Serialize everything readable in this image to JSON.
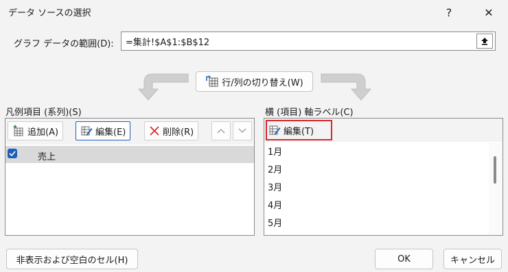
{
  "window": {
    "title": "データ ソースの選択",
    "help": "?",
    "close": "✕"
  },
  "range": {
    "label": "グラフ データの範囲(D):",
    "value": "=集計!$A$1:$B$12"
  },
  "switch_button": {
    "label": "行/列の切り替え(W)"
  },
  "legend": {
    "header": "凡例項目 (系列)(S)",
    "add": "追加(A)",
    "edit": "編集(E)",
    "delete": "削除(R)",
    "series": [
      {
        "label": "売上",
        "checked": true
      }
    ]
  },
  "axis": {
    "header": "横 (項目) 軸ラベル(C)",
    "edit": "編集(T)",
    "items": [
      "1月",
      "2月",
      "3月",
      "4月",
      "5月"
    ]
  },
  "footer": {
    "hidden_cells": "非表示および空白のセル(H)",
    "ok": "OK",
    "cancel": "キャンセル"
  },
  "colors": {
    "accent": "#1d5fb8",
    "highlight": "#d9262c"
  },
  "icons": [
    "help-icon",
    "close-icon",
    "collapse-dialog-icon",
    "switch-row-column-icon",
    "add-icon",
    "edit-icon",
    "delete-icon",
    "move-up-icon",
    "move-down-icon",
    "check-icon",
    "arrow-left-icon",
    "arrow-right-icon"
  ]
}
